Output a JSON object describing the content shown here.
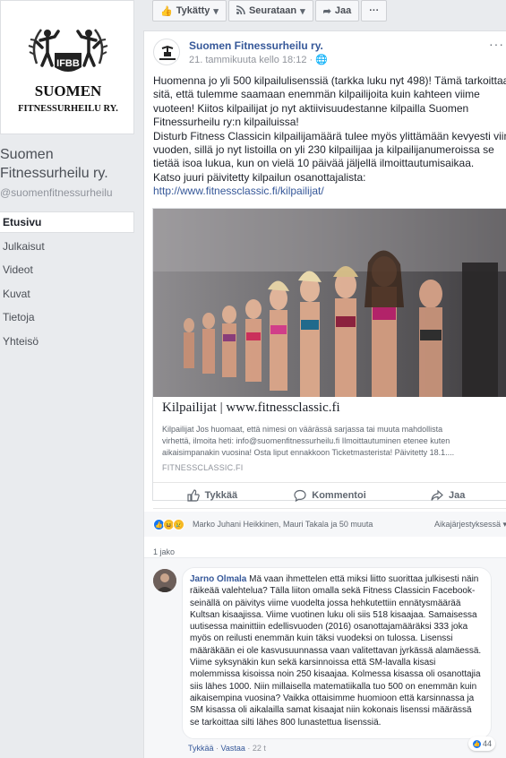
{
  "sidebar": {
    "logo_top_text": "IFBB",
    "logo_line1": "SUOMEN",
    "logo_line2": "FITNESSURHEILU RY.",
    "page_name": "Suomen Fitnessurheilu ry.",
    "page_handle": "@suomenfitnessurheilu",
    "nav": [
      {
        "label": "Etusivu",
        "active": true
      },
      {
        "label": "Julkaisut"
      },
      {
        "label": "Videot"
      },
      {
        "label": "Kuvat"
      },
      {
        "label": "Tietoja"
      },
      {
        "label": "Yhteisö"
      }
    ]
  },
  "top_actions": {
    "like_label": "Tykätty",
    "follow_label": "Seurataan",
    "share_label": "Jaa",
    "more_label": "···"
  },
  "post": {
    "author": "Suomen Fitnessurheilu ry.",
    "time": "21. tammikuuta kello 18:12 · ",
    "options": "···",
    "lines": [
      "Huomenna jo yli 500 kilpailulisenssiä (tarkka luku nyt 498)! Tämä tarkoittaa",
      "sitä, että tulemme saamaan enemmän kilpailijoita kuin kahteen viime",
      "vuoteen! Kiitos kilpailijat jo nyt aktiivisuudestanne kilpailla Suomen",
      "Fitnessurheilu ry:n kilpailuissa!",
      "Disturb Fitness Classicin kilpailijamäärä tulee myös ylittämään kevyesti viime",
      "vuoden, sillä jo nyt listoilla on yli 230 kilpailijaa ja kilpailijanumeroissa se",
      "tietää isoa lukua, kun on vielä 10 päivää jäljellä ilmoittautumisaikaa.",
      "Katso juuri päivitetty kilpailun osanottajalista:"
    ],
    "link_url": "http://www.fitnessclassic.fi/kilpailijat/",
    "link_card": {
      "title": "Kilpailijat | www.fitnessclassic.fi",
      "desc_lines": [
        "Kilpailijat Jos huomaat, että nimesi on väärässä sarjassa tai muuta mahdollista",
        "virhettä, ilmoita heti: info@suomenfitnessurheilu.fi Ilmoittautuminen etenee kuten",
        "aikaisimpanakin vuosina! Osta liput ennakkoon Ticketmasterista! Päivitetty 18.1...."
      ],
      "domain": "FITNESSCLASSIC.FI"
    },
    "actions": {
      "like": "Tykkää",
      "comment": "Kommentoi",
      "share": "Jaa"
    },
    "reactions": {
      "names": "Marko Juhani Heikkinen, Mauri Takala ja 50 muuta",
      "sort": "Aikajärjestyksessä ▾",
      "like_color": "#1877f2",
      "haha_color": "#f7b928",
      "sad_color": "#f7b928"
    },
    "share_count": "1 jako"
  },
  "comment": {
    "author": "Jarno Olmala",
    "text": "Mä vaan ihmettelen että miksi liitto suorittaa julkisesti näin räikeää valehtelua? Tälla liiton omalla sekä Fitness Classicin Facebook-seinällä on päivitys viime vuodelta jossa hehkutettiin ennätysmäärää Kultsan kisaajissa. Viime vuotinen luku oli siis 518 kisaajaa. Samaisessa uutisessa mainittiin edellisvuoden (2016) osanottajamääräksi 333 joka myös on reilusti enemmän kuin täksi vuodeksi on tulossa. Lisenssi määräkään ei ole kasvusuunnassa vaan valitettavan jyrkässä alamäessä. Viime syksynäkin kun sekä karsinnoissa että SM-lavalla kisasi molemmissa kisoissa noin 250 kisaajaa. Kolmessa kisassa oli osanottajia siis lähes 1000. Niin millaisella matematiikalla tuo 500 on enemmän kuin aikaisempina vuosina? Vaikka ottaisimme huomioon että karsinnassa ja SM kisassa oli aikalailla samat kisaajat niin kokonais lisenssi määrässä se tarkoittaa silti lähes 800 lunastettua lisenssiä.",
    "like_count": "44",
    "meta_like": "Tykkää",
    "meta_reply": "Vastaa",
    "meta_time": "22 t"
  }
}
